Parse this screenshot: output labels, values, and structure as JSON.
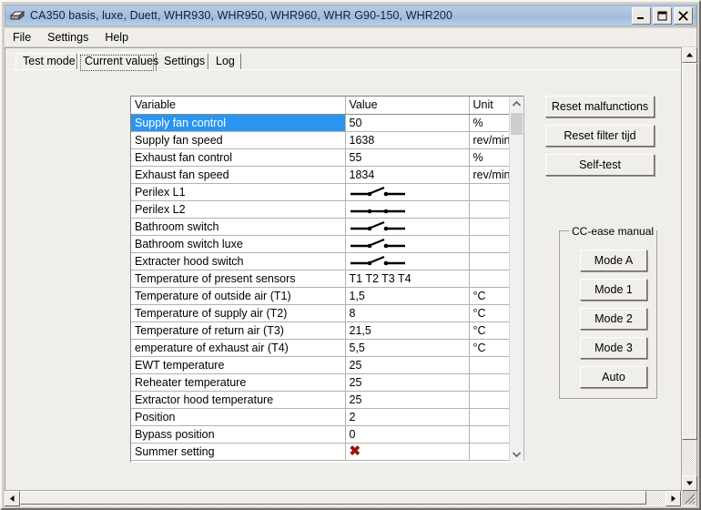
{
  "window": {
    "title": "CA350 basis, luxe, Duett, WHR930, WHR950, WHR960, WHR G90-150, WHR200",
    "icon": "box-icon",
    "controls": {
      "minimize": "minimize-icon",
      "maximize": "maximize-icon",
      "close": "close-icon"
    }
  },
  "menubar": {
    "items": [
      {
        "label": "File"
      },
      {
        "label": "Settings"
      },
      {
        "label": "Help"
      }
    ]
  },
  "tabs": {
    "items": [
      {
        "label": "Test mode",
        "active": false
      },
      {
        "label": "Current values",
        "active": true
      },
      {
        "label": "Settings",
        "active": false
      },
      {
        "label": "Log",
        "active": false
      }
    ]
  },
  "table": {
    "columns": [
      "Variable",
      "Value",
      "Unit"
    ],
    "rows": [
      {
        "variable": "Supply fan control",
        "value": "50",
        "unit": "%",
        "selected": true,
        "type": "text"
      },
      {
        "variable": "Supply fan speed",
        "value": "1638",
        "unit": "rev/min",
        "selected": false,
        "type": "text"
      },
      {
        "variable": "Exhaust fan control",
        "value": "55",
        "unit": "%",
        "selected": false,
        "type": "text"
      },
      {
        "variable": "Exhaust fan speed",
        "value": "1834",
        "unit": "rev/min",
        "selected": false,
        "type": "text"
      },
      {
        "variable": "Perilex L1",
        "value": "",
        "unit": "",
        "selected": false,
        "type": "switch-open"
      },
      {
        "variable": "Perilex L2",
        "value": "",
        "unit": "",
        "selected": false,
        "type": "switch-closed"
      },
      {
        "variable": "Bathroom switch",
        "value": "",
        "unit": "",
        "selected": false,
        "type": "switch-open"
      },
      {
        "variable": "Bathroom switch luxe",
        "value": "",
        "unit": "",
        "selected": false,
        "type": "switch-open"
      },
      {
        "variable": "Extracter hood switch",
        "value": "",
        "unit": "",
        "selected": false,
        "type": "switch-open"
      },
      {
        "variable": "Temperature of present sensors",
        "value": "T1 T2 T3 T4",
        "unit": "",
        "selected": false,
        "type": "text"
      },
      {
        "variable": "Temperature of outside air (T1)",
        "value": "1,5",
        "unit": "°C",
        "selected": false,
        "type": "text"
      },
      {
        "variable": "Temperature of supply air (T2)",
        "value": "8",
        "unit": "°C",
        "selected": false,
        "type": "text"
      },
      {
        "variable": "Temperature of return air (T3)",
        "value": "21,5",
        "unit": "°C",
        "selected": false,
        "type": "text"
      },
      {
        "variable": "emperature of exhaust air (T4)",
        "value": "5,5",
        "unit": "°C",
        "selected": false,
        "type": "text"
      },
      {
        "variable": "EWT temperature",
        "value": "25",
        "unit": "",
        "selected": false,
        "type": "text"
      },
      {
        "variable": "Reheater temperature",
        "value": "25",
        "unit": "",
        "selected": false,
        "type": "text"
      },
      {
        "variable": "Extractor hood temperature",
        "value": "25",
        "unit": "",
        "selected": false,
        "type": "text"
      },
      {
        "variable": "Position",
        "value": "2",
        "unit": "",
        "selected": false,
        "type": "text"
      },
      {
        "variable": "Bypass position",
        "value": "0",
        "unit": "",
        "selected": false,
        "type": "text"
      },
      {
        "variable": "Summer setting",
        "value": "✖",
        "unit": "",
        "selected": false,
        "type": "redx"
      }
    ]
  },
  "actions": {
    "reset_malfunctions": "Reset malfunctions",
    "reset_filter": "Reset filter tijd",
    "self_test": "Self-test"
  },
  "ccease": {
    "title": "CC-ease manual",
    "buttons": [
      {
        "label": "Mode A"
      },
      {
        "label": "Mode 1"
      },
      {
        "label": "Mode 2"
      },
      {
        "label": "Mode 3"
      },
      {
        "label": "Auto"
      }
    ]
  },
  "colors": {
    "selection": "#2a95f0",
    "titlebar": "#a9c2e0",
    "face": "#f0eeeb",
    "redx": "#9e1111"
  }
}
